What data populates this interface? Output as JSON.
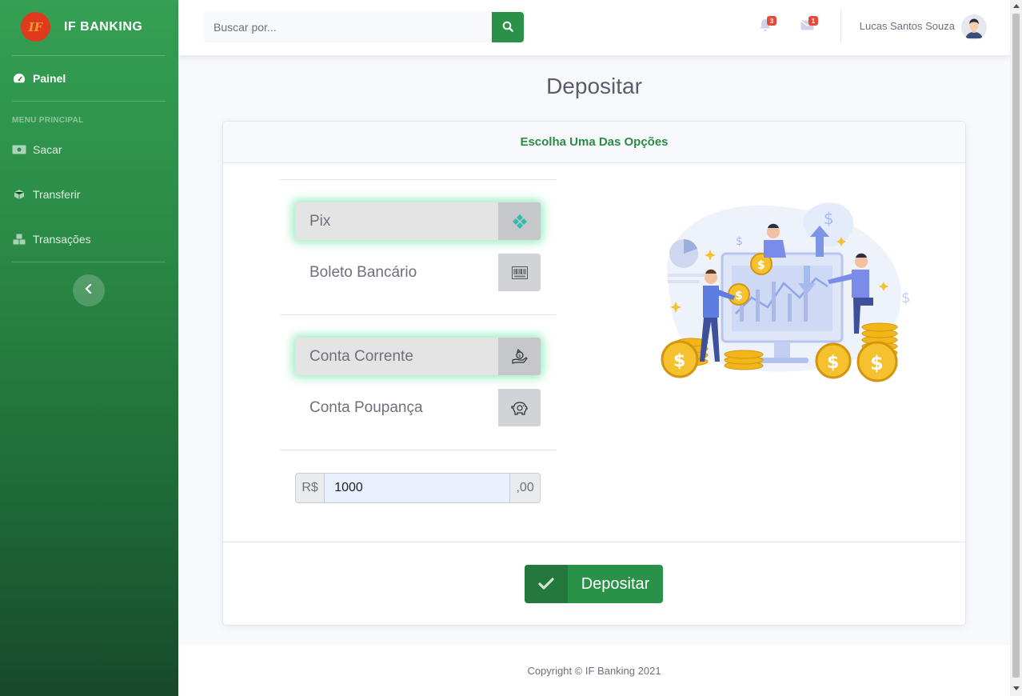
{
  "brand": {
    "name": "IF BANKING",
    "logo_text": "IF"
  },
  "sidebar": {
    "dashboard": "Painel",
    "heading": "MENU PRINCIPAL",
    "items": [
      {
        "label": "Sacar",
        "icon": "money-bill-icon"
      },
      {
        "label": "Transferir",
        "icon": "cube-icon"
      },
      {
        "label": "Transações",
        "icon": "cubes-icon"
      }
    ]
  },
  "topbar": {
    "search_placeholder": "Buscar por...",
    "alerts_count": "3",
    "messages_count": "1",
    "user_name": "Lucas Santos Souza"
  },
  "page": {
    "title": "Depositar"
  },
  "card": {
    "header": "Escolha Uma Das Opções",
    "payment_options": [
      {
        "label": "Pix",
        "selected": true,
        "icon": "pix-icon"
      },
      {
        "label": "Boleto Bancário",
        "selected": false,
        "icon": "barcode-icon"
      }
    ],
    "account_options": [
      {
        "label": "Conta Corrente",
        "selected": true,
        "icon": "money-hand-icon"
      },
      {
        "label": "Conta Poupança",
        "selected": false,
        "icon": "piggy-bank-icon"
      }
    ],
    "amount": {
      "prefix": "R$",
      "value": "1000",
      "suffix": ",00"
    },
    "submit_label": "Depositar"
  },
  "footer": {
    "copyright": "Copyright © IF Banking 2021"
  },
  "colors": {
    "primary": "#2a9149",
    "primary_dark": "#24773d",
    "badge": "#e74a3b",
    "glow": "#50dc96"
  }
}
